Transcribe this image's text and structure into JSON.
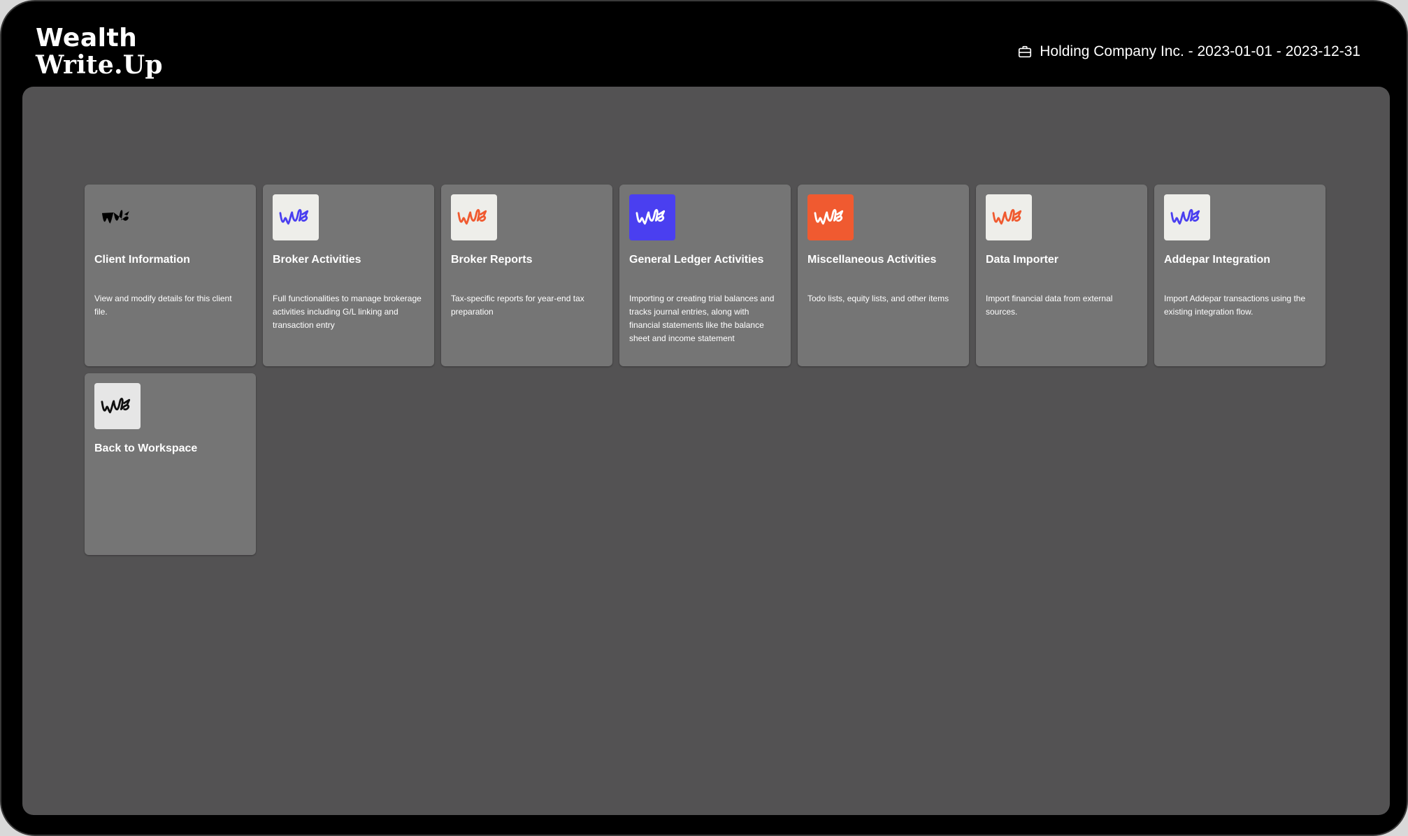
{
  "brand": {
    "line1": "Wealth",
    "line2": "Write.Up"
  },
  "header": {
    "context": "Holding Company Inc. - 2023-01-01 - 2023-12-31",
    "icon": "briefcase-icon"
  },
  "cards": [
    {
      "title": "Client Information",
      "description": "View and modify details for this client file.",
      "icon": "wu-logo-icon",
      "tile_bg": "#222222",
      "stroke": "#ffffff"
    },
    {
      "title": "Broker Activities",
      "description": "Full functionalities to manage brokerage activities including G/L linking and transaction entry",
      "icon": "wu-logo-icon",
      "tile_bg": "#eeeeea",
      "stroke": "#4a3ff0"
    },
    {
      "title": "Broker Reports",
      "description": "Tax-specific reports for year-end tax preparation",
      "icon": "wu-logo-icon",
      "tile_bg": "#eeeeea",
      "stroke": "#f05a30"
    },
    {
      "title": "General Ledger Activities",
      "description": "Importing or creating trial balances and tracks journal entries, along with financial statements like the balance sheet and income statement",
      "icon": "wu-logo-icon",
      "tile_bg": "#4a3ff0",
      "stroke": "#ffffff"
    },
    {
      "title": "Miscellaneous Activities",
      "description": "Todo lists, equity lists, and other items",
      "icon": "wu-logo-icon",
      "tile_bg": "#f05a30",
      "stroke": "#ffffff"
    },
    {
      "title": "Data Importer",
      "description": "Import financial data from external sources.",
      "icon": "wu-logo-icon",
      "tile_bg": "#eeeeea",
      "stroke": "#f05a30"
    },
    {
      "title": "Addepar Integration",
      "description": "Import Addepar transactions using the existing integration flow.",
      "icon": "wu-logo-icon",
      "tile_bg": "#eeeeea",
      "stroke": "#4a3ff0"
    },
    {
      "title": "Back to Workspace",
      "description": "",
      "icon": "wu-logo-icon",
      "tile_bg": "#e6e6e6",
      "stroke": "#111111"
    }
  ]
}
